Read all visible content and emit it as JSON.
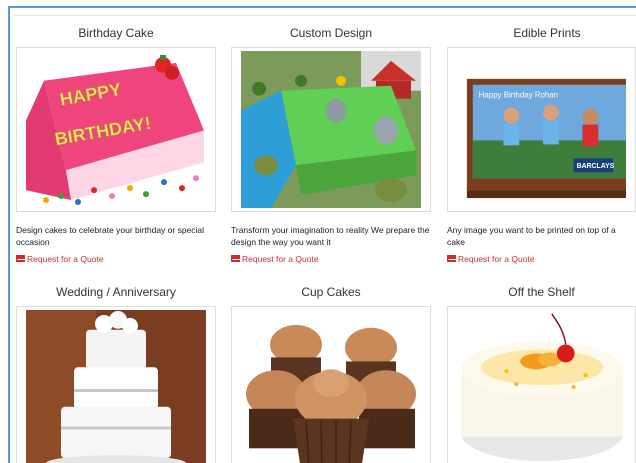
{
  "products": [
    {
      "title": "Birthday Cake",
      "image_text_1": "HAPPY",
      "image_text_2": "BIRTHDAY!",
      "description": "Design cakes to celebrate your birthday or special occasion",
      "quote_label": "Request for a Quote"
    },
    {
      "title": "Custom Design",
      "description": "Transform your imagination to reality We prepare the design the way you want it",
      "quote_label": "Request for a Quote"
    },
    {
      "title": "Edible Prints",
      "image_text_1": "Happy Birthday Rohan",
      "image_text_2": "BARCLAYS",
      "description": "Any image you want to be printed on top of a cake",
      "quote_label": "Request for a Quote"
    },
    {
      "title": "Wedding / Anniversary"
    },
    {
      "title": "Cup Cakes"
    },
    {
      "title": "Off the Shelf"
    }
  ],
  "colors": {
    "frame": "#5b9bd5",
    "quote_link": "#c9302c",
    "birthday_pink": "#f0457c"
  },
  "icons": {
    "quote": "envelope-icon"
  }
}
